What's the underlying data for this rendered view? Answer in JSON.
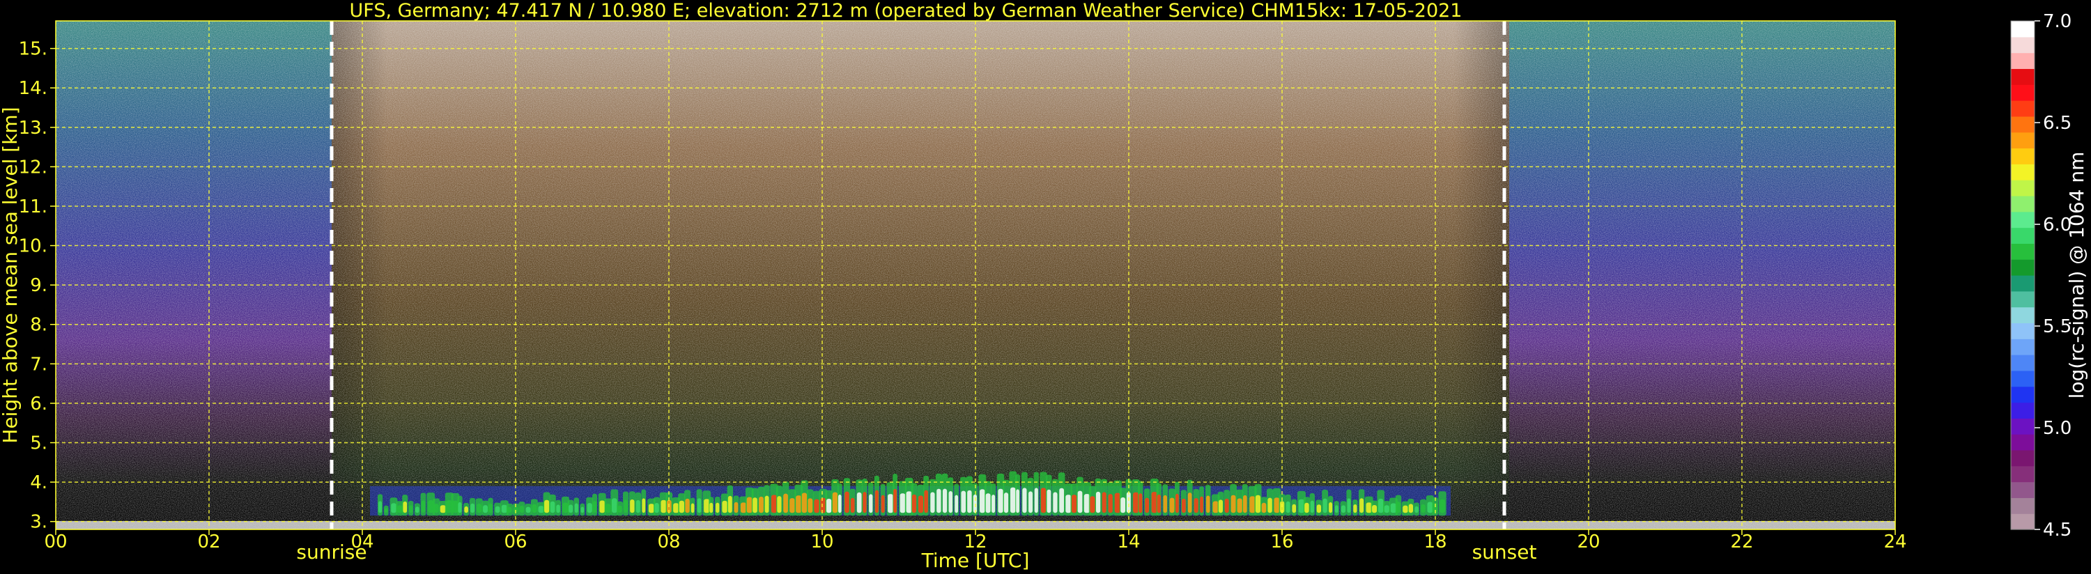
{
  "chart_data": {
    "type": "heatmap",
    "title": "UFS, Germany; 47.417 N / 10.980 E; elevation: 2712 m  (operated by German Weather Service)    CHM15kx: 17-05-2021",
    "xlabel": "Time [UTC]",
    "ylabel": "Height above mean sea level [km]",
    "xlim": [
      0,
      24
    ],
    "ylim": [
      2.8,
      15.7
    ],
    "x_ticks": [
      "00",
      "02",
      "04",
      "06",
      "08",
      "10",
      "12",
      "14",
      "16",
      "18",
      "20",
      "22",
      "24"
    ],
    "y_ticks": [
      "3.",
      "4.",
      "5.",
      "6.",
      "7.",
      "8.",
      "9.",
      "10.",
      "11.",
      "12.",
      "13.",
      "14.",
      "15."
    ],
    "events": [
      {
        "label": "sunrise",
        "time": 3.6
      },
      {
        "label": "sunset",
        "time": 18.9
      }
    ],
    "grid": true,
    "colorbar": {
      "label": "log(rc-signal) @ 1064 nm",
      "range": [
        4.5,
        7.0
      ],
      "ticks": [
        "4.5",
        "5.0",
        "5.5",
        "6.0",
        "6.5",
        "7.0"
      ],
      "colors": [
        "#b89aa8",
        "#a4829a",
        "#92578c",
        "#862f7a",
        "#7a1670",
        "#7d0d9a",
        "#6c12c2",
        "#3c1ee6",
        "#1f34f2",
        "#2c61f5",
        "#4e86f6",
        "#6ea5f8",
        "#8fc3f8",
        "#8fd7df",
        "#4fbfa0",
        "#1a9a72",
        "#149a2c",
        "#27bf3c",
        "#39d86a",
        "#5ceb8e",
        "#8ff06e",
        "#c0f548",
        "#f3f326",
        "#ffcc10",
        "#ff9f10",
        "#ff7410",
        "#ff3d14",
        "#ff0f18",
        "#e60d12",
        "#ffb0b0",
        "#f6dada",
        "#ffffff"
      ]
    }
  }
}
